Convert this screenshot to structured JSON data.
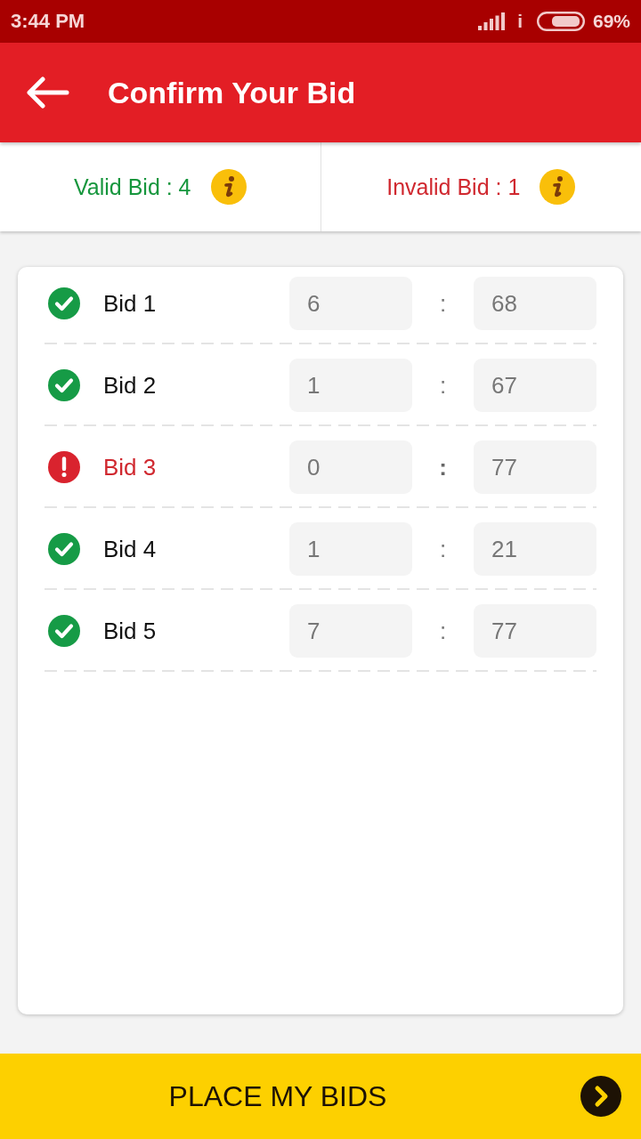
{
  "status_bar": {
    "time": "3:44 PM",
    "indicator": "i",
    "battery": "69%"
  },
  "app_bar": {
    "title": "Confirm Your Bid"
  },
  "summary": [
    {
      "kind": "valid",
      "label": "Valid Bid : 4"
    },
    {
      "kind": "invalid",
      "label": "Invalid Bid : 1"
    }
  ],
  "bids": [
    {
      "label": "Bid 1",
      "valid": true,
      "first": "6",
      "separator": ":",
      "second": "68"
    },
    {
      "label": "Bid 2",
      "valid": true,
      "first": "1",
      "separator": ":",
      "second": "67"
    },
    {
      "label": "Bid 3",
      "valid": false,
      "first": "0",
      "separator": ":",
      "second": "77"
    },
    {
      "label": "Bid 4",
      "valid": true,
      "first": "1",
      "separator": ":",
      "second": "21"
    },
    {
      "label": "Bid 5",
      "valid": true,
      "first": "7",
      "separator": ":",
      "second": "77"
    }
  ],
  "button": {
    "label": "PLACE MY BIDS"
  }
}
